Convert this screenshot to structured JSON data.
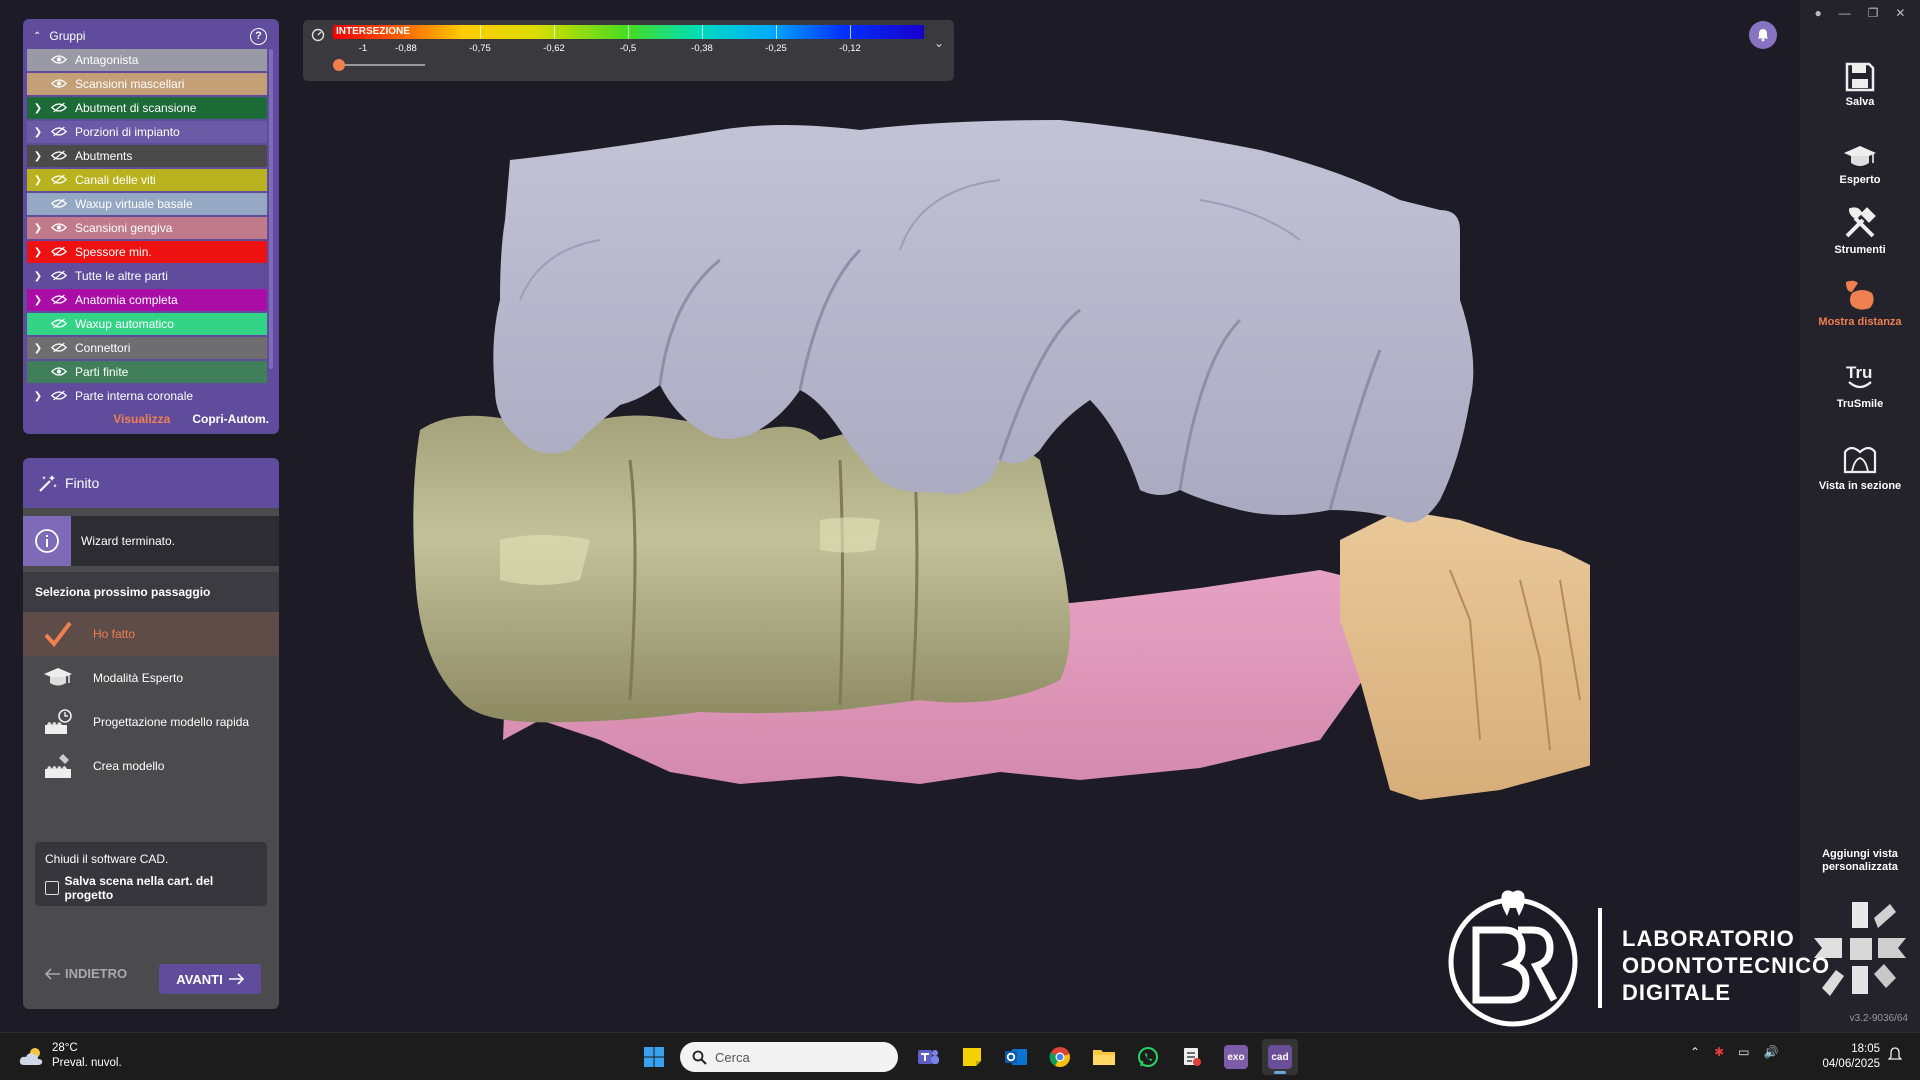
{
  "groups": {
    "title": "Gruppi",
    "help": "?",
    "items": [
      {
        "label": "Antagonista",
        "color": "#9a9aa6",
        "visible": true,
        "expandable": false
      },
      {
        "label": "Scansioni mascellari",
        "color": "#c49e75",
        "visible": true,
        "expandable": false
      },
      {
        "label": "Abutment di scansione",
        "color": "#1c6a35",
        "visible": false,
        "expandable": true
      },
      {
        "label": "Porzioni di impianto",
        "color": "#6a5aa6",
        "visible": false,
        "expandable": true
      },
      {
        "label": "Abutments",
        "color": "#4a4a4a",
        "visible": false,
        "expandable": true
      },
      {
        "label": "Canali delle viti",
        "color": "#b8b21f",
        "visible": false,
        "expandable": true
      },
      {
        "label": "Waxup virtuale basale",
        "color": "#94a8c4",
        "visible": false,
        "expandable": false
      },
      {
        "label": "Scansioni gengiva",
        "color": "#c07a8a",
        "visible": true,
        "expandable": true
      },
      {
        "label": "Spessore min.",
        "color": "#ee1111",
        "visible": false,
        "expandable": true
      },
      {
        "label": "Tutte le altre parti",
        "color": "#5f4c9c",
        "visible": false,
        "expandable": true
      },
      {
        "label": "Anatomia completa",
        "color": "#aa0da6",
        "visible": false,
        "expandable": true
      },
      {
        "label": "Waxup automatico",
        "color": "#33d488",
        "visible": false,
        "expandable": false
      },
      {
        "label": "Connettori",
        "color": "#6e6e70",
        "visible": false,
        "expandable": true
      },
      {
        "label": "Parti finite",
        "color": "#3f805a",
        "visible": true,
        "expandable": false
      },
      {
        "label": "Parte interna coronale",
        "color": "#5f4c9c",
        "visible": false,
        "expandable": true
      }
    ],
    "footer": {
      "visualizza": "Visualizza",
      "copri": "Copri-Autom."
    }
  },
  "wizard": {
    "title": "Finito",
    "info": "Wizard terminato.",
    "select_heading": "Seleziona prossimo passaggio",
    "steps": [
      {
        "label": "Ho fatto",
        "icon": "check-icon",
        "active": true
      },
      {
        "label": "Modalità Esperto",
        "icon": "graduation-cap-icon",
        "active": false
      },
      {
        "label": "Progettazione modello rapida",
        "icon": "quick-model-icon",
        "active": false
      },
      {
        "label": "Crea modello",
        "icon": "create-model-icon",
        "active": false
      }
    ],
    "close_text": "Chiudi il software CAD.",
    "save_scene": "Salva scena nella cart. del progetto",
    "back": "INDIETRO",
    "next": "AVANTI"
  },
  "scale": {
    "label": "INTERSEZIONE",
    "ticks": [
      "-1",
      "-0,88",
      "-0,75",
      "-0,62",
      "-0,5",
      "-0,38",
      "-0,25",
      "-0,12"
    ],
    "slider_value": 0
  },
  "toolbar": {
    "tools": [
      {
        "label": "Salva",
        "icon": "save-icon",
        "active": false
      },
      {
        "label": "Esperto",
        "icon": "graduation-cap-icon",
        "active": false
      },
      {
        "label": "Strumenti",
        "icon": "tools-icon",
        "active": false
      },
      {
        "label": "Mostra distanza",
        "icon": "distance-icon",
        "active": true
      },
      {
        "label": "TruSmile",
        "icon": "trusmile-icon",
        "active": false
      },
      {
        "label": "Vista in sezione",
        "icon": "section-view-icon",
        "active": false
      }
    ],
    "add_view": "Aggiungi vista personalizzata",
    "version": "v3.2-9036/64",
    "accent": "#f08050"
  },
  "logo": {
    "monogram": "BR",
    "line1": "LABORATORIO",
    "line2": "ODONTOTECNICO",
    "line3": "DIGITALE"
  },
  "taskbar": {
    "weather_temp": "28°C",
    "weather_desc": "Preval. nuvol.",
    "search_placeholder": "Cerca",
    "time": "18:05",
    "date": "04/06/2025",
    "apps": [
      "start-icon",
      "search",
      "teams-icon",
      "sticky-notes-icon",
      "outlook-icon",
      "chrome-icon",
      "file-explorer-icon",
      "whatsapp-icon",
      "snipping-icon",
      "exocad-icon",
      "cad-icon"
    ],
    "exo_label": "exo",
    "cad_label": "cad"
  }
}
